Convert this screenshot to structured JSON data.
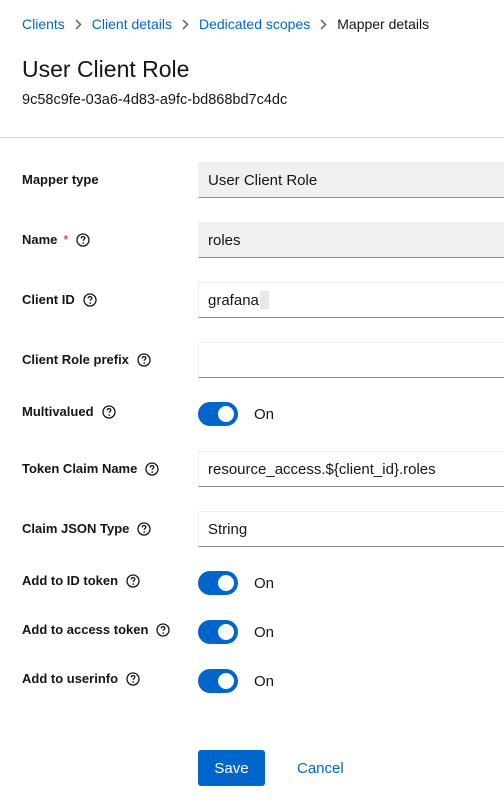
{
  "breadcrumb": {
    "items": [
      "Clients",
      "Client details",
      "Dedicated scopes"
    ],
    "current": "Mapper details"
  },
  "header": {
    "title": "User Client Role",
    "id": "9c58c9fe-03a6-4d83-a9fc-bd868bd7c4dc"
  },
  "form": {
    "mapper_type": {
      "label": "Mapper type",
      "value": "User Client Role"
    },
    "name": {
      "label": "Name",
      "required_mark": "*",
      "value": "roles"
    },
    "client_id": {
      "label": "Client ID",
      "value": "grafana"
    },
    "client_role_prefix": {
      "label": "Client Role prefix",
      "value": ""
    },
    "multivalued": {
      "label": "Multivalued",
      "state": "On"
    },
    "token_claim_name": {
      "label": "Token Claim Name",
      "value": "resource_access.${client_id}.roles"
    },
    "claim_json_type": {
      "label": "Claim JSON Type",
      "value": "String"
    },
    "add_to_id_token": {
      "label": "Add to ID token",
      "state": "On"
    },
    "add_to_access_token": {
      "label": "Add to access token",
      "state": "On"
    },
    "add_to_userinfo": {
      "label": "Add to userinfo",
      "state": "On"
    }
  },
  "actions": {
    "save": "Save",
    "cancel": "Cancel"
  },
  "colors": {
    "accent": "#0066cc",
    "required": "#c9190b",
    "readonly_bg": "#f0f0f0"
  },
  "icons": {
    "help": "help-circle-icon",
    "separator": "chevron-right-icon"
  }
}
